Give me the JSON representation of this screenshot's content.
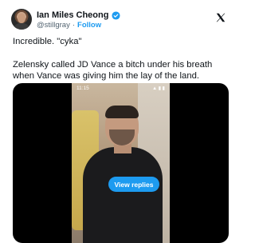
{
  "author": {
    "name": "Ian Miles Cheong",
    "handle": "@stillgray",
    "separator": "·",
    "follow_label": "Follow"
  },
  "icons": {
    "verified": "verified-badge-icon",
    "platform": "x-logo-icon"
  },
  "colors": {
    "accent": "#1d9bf0",
    "text": "#0f1419",
    "muted": "#536471"
  },
  "tweet": {
    "line1": "Incredible. \"cyka\"",
    "line2": "Zelensky called JD Vance a bitch under his breath when Vance was giving him the lay of the land."
  },
  "media": {
    "status_time": "11:15",
    "status_icons": "▲ ▮ ▮",
    "view_replies_label": "View replies"
  }
}
